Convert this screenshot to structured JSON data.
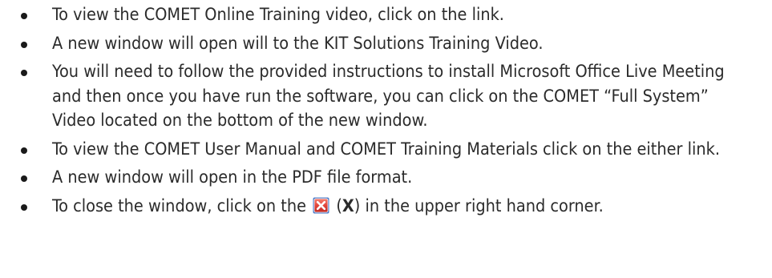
{
  "bullets": [
    {
      "text": "To view the COMET Online Training video, click on the link."
    },
    {
      "text": "A new window will open will to the KIT Solutions Training Video."
    },
    {
      "text": "You will need to follow the provided instructions to install Microsoft Office Live Meeting and then once you have run the software, you can click on the COMET “Full System” Video located on the bottom of the new window."
    },
    {
      "text": "To view the COMET User Manual and COMET Training Materials click on the either link."
    },
    {
      "text": "A new window will open in the PDF file format."
    },
    {
      "text_before": "To close the window, click on the",
      "icon": "close-window-icon",
      "paren_open": "(",
      "x_label": "X",
      "paren_close": ")",
      "text_after": "in the upper right hand corner."
    }
  ],
  "colors": {
    "text": "#2b2b2b",
    "close_icon_fill": "#e2453c",
    "close_icon_border": "#4a78c7"
  }
}
